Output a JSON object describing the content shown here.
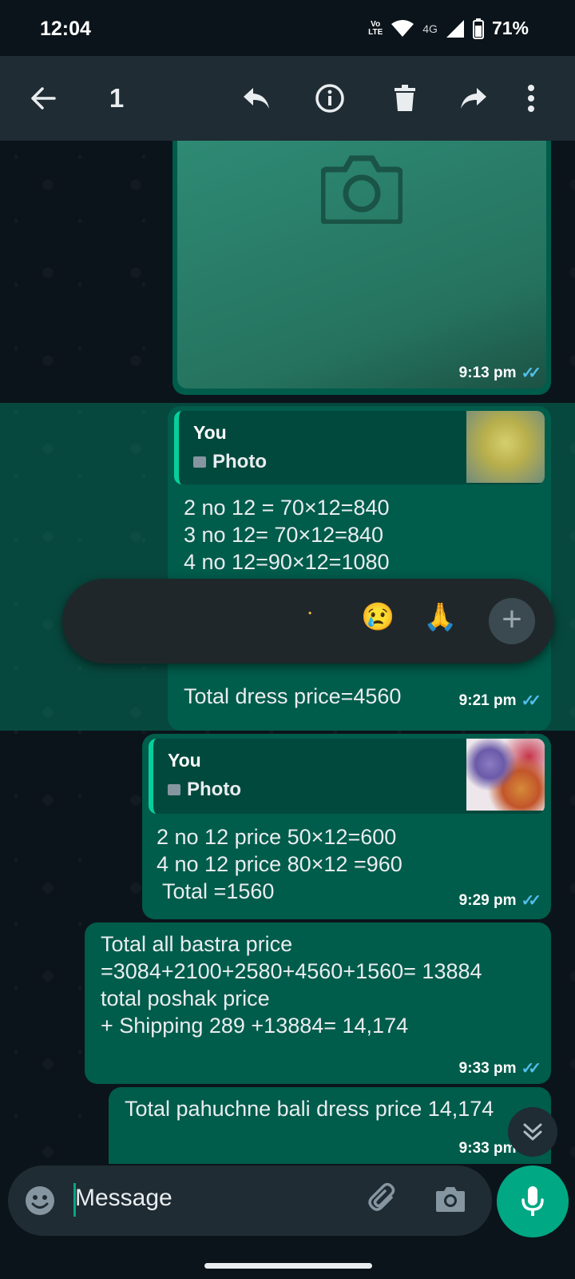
{
  "status_bar": {
    "time": "12:04",
    "volte_top": "Vo",
    "volte_bottom": "LTE",
    "network": "4G",
    "battery": "71%"
  },
  "toolbar": {
    "selected_count": "1"
  },
  "messages": [
    {
      "time": "9:13 pm"
    },
    {
      "quote_author": "You",
      "quote_type": "Photo",
      "lines": [
        "2 no 12 = 70×12=840",
        "3 no 12= 70×12=840",
        "4 no 12=90×12=1080"
      ],
      "last_line": "Total dress price=4560",
      "time": "9:21 pm"
    },
    {
      "quote_author": "You",
      "quote_type": "Photo",
      "text": "2 no 12 price 50×12=600\n4 no 12 price 80×12 =960\n Total =1560",
      "time": "9:29 pm"
    },
    {
      "text": "Total all bastra price\n=3084+2100+2580+4560+1560= 13884\ntotal poshak price\n+ Shipping 289 +13884= 14,174",
      "time": "9:33 pm"
    },
    {
      "text": "Total pahuchne bali dress price 14,174",
      "time": "9:33 pm"
    }
  ],
  "reactions": [
    "•",
    "😢",
    "🙏",
    "+"
  ],
  "composer": {
    "placeholder": "Message"
  },
  "colors": {
    "outgoing_bubble": "#005c4b",
    "accent": "#00a884",
    "read_ticks": "#53bdeb"
  }
}
